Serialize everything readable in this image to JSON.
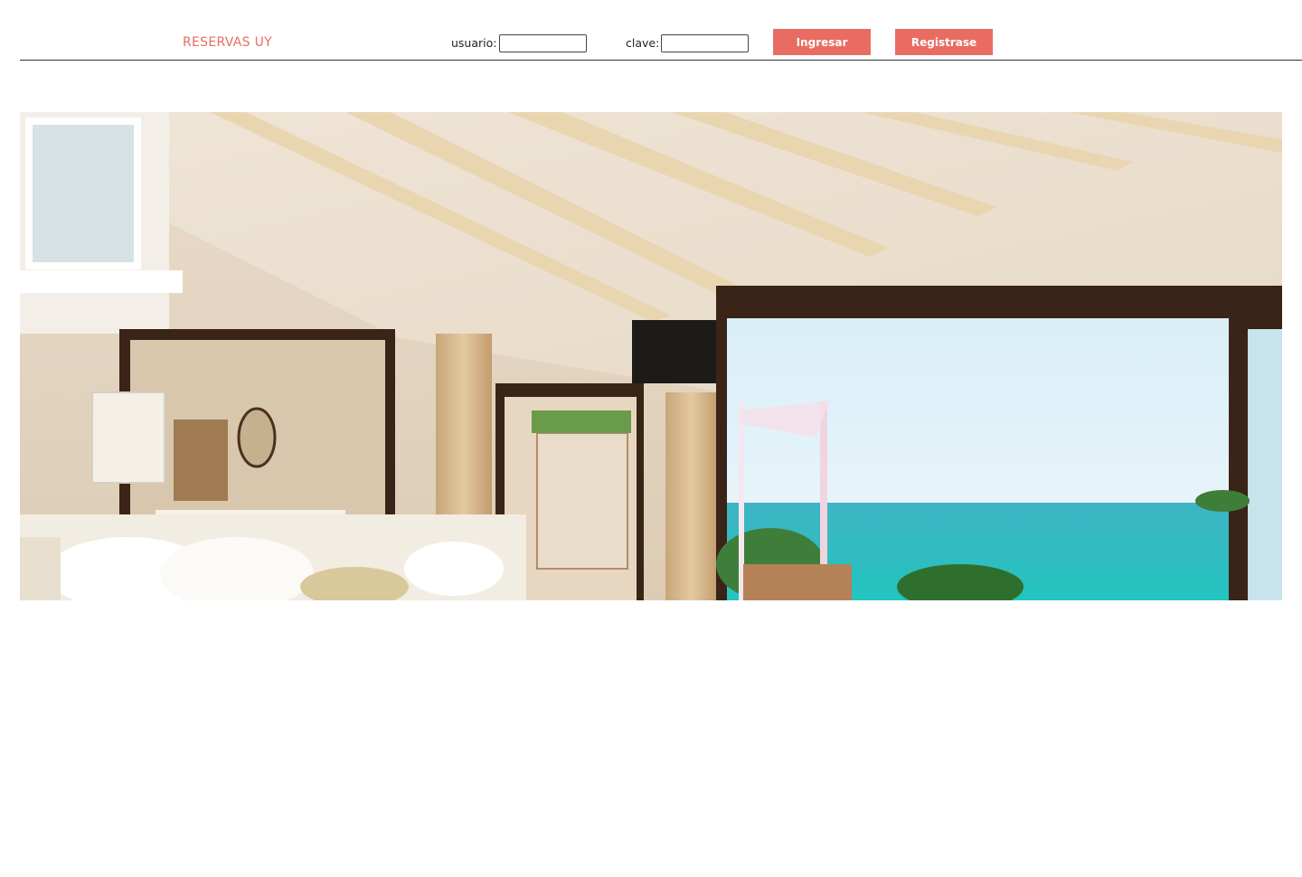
{
  "header": {
    "brand": "RESERVAS UY",
    "user_label": "usuario:",
    "user_value": "",
    "password_label": "clave:",
    "password_value": "",
    "login_button": "Ingresar",
    "register_button": "Registrase"
  },
  "hero": {
    "image": "hotel-room-ocean-view"
  },
  "colors": {
    "accent": "#e96c62",
    "divider": "#333333"
  }
}
